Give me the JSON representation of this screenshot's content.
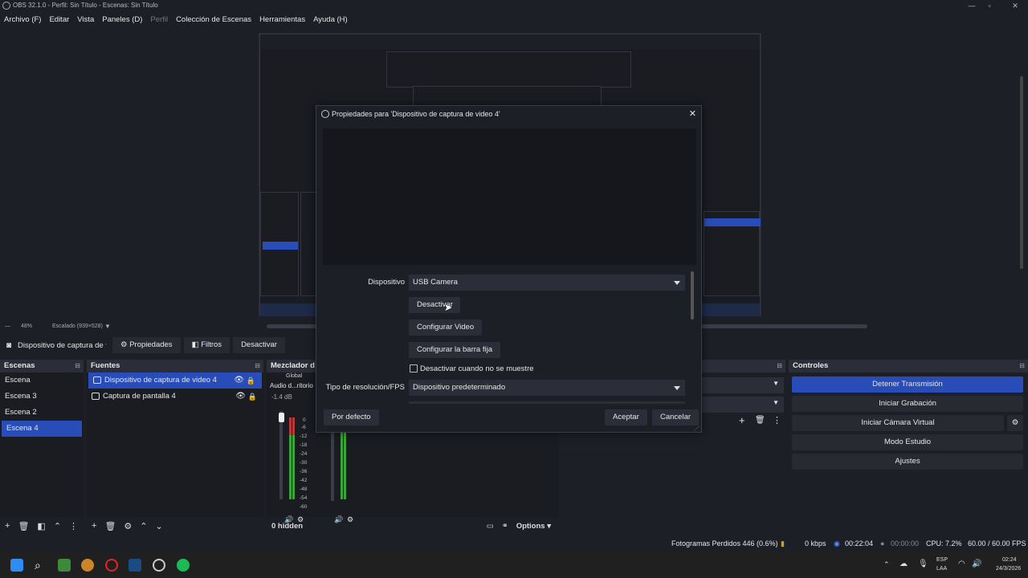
{
  "window": {
    "title": "OBS 32.1.0 - Perfil: Sin Título - Escenas: Sin Título"
  },
  "menu": [
    "Archivo (F)",
    "Editar",
    "Vista",
    "Paneles (D)",
    "Perfil",
    "Colección de Escenas",
    "Herramientas",
    "Ayuda (H)"
  ],
  "preview_footer": {
    "zoom": "48%",
    "scale": "Escalado (939×528)"
  },
  "context": {
    "source_name": "Dispositivo de captura de v",
    "properties": "Propiedades",
    "filters": "Filtros",
    "deactivate": "Desactivar"
  },
  "scenes": {
    "title": "Escenas",
    "items": [
      "Escena",
      "Escena 3",
      "Escena 2",
      "Escena 4"
    ]
  },
  "sources": {
    "title": "Fuentes",
    "items": [
      "Dispositivo de captura de video 4",
      "Captura de pantalla 4"
    ]
  },
  "mixer": {
    "title": "Mezclador d",
    "global": "Global",
    "channel": "Audio d...ritorio",
    "db": "-1.4 dB",
    "ticks": [
      "0",
      "-6",
      "-12",
      "-18",
      "-24",
      "-30",
      "-36",
      "-42",
      "-48",
      "-54",
      "-60"
    ],
    "hidden": "0 hidden",
    "options": "Options"
  },
  "controls": {
    "title": "Controles",
    "stop_stream": "Detener Transmisión",
    "start_record": "Iniciar Grabación",
    "start_vcam": "Iniciar Cámara Virtual",
    "studio": "Modo Estudio",
    "settings": "Ajustes"
  },
  "status": {
    "dropped": "Fotogramas Perdidos 446 (0.6%)",
    "kbps": "0 kbps",
    "stream_time": "00:22:04",
    "rec_time": "00:00:00",
    "cpu": "CPU: 7.2%",
    "fps": "60.00 / 60.00 FPS"
  },
  "taskbar": {
    "lang1": "ESP",
    "lang2": "LAA",
    "time": "02:24",
    "date": "24/3/2026"
  },
  "dialog": {
    "title": "Propiedades para 'Dispositivo de captura de video 4'",
    "device_label": "Dispositivo",
    "device_value": "USB Camera",
    "deactivate": "Desactivar",
    "configure_video": "Configurar Video",
    "configure_crossbar": "Configurar la barra fija",
    "deactivate_hidden": "Desactivar cuando no se muestre",
    "resolution_label": "Tipo de resolución/FPS",
    "resolution_value": "Dispositivo predeterminado",
    "defaults": "Por defecto",
    "accept": "Aceptar",
    "cancel": "Cancelar"
  },
  "colors": {
    "accent": "#284cb8",
    "background": "#1d1f26",
    "panel": "#1a1c22"
  }
}
